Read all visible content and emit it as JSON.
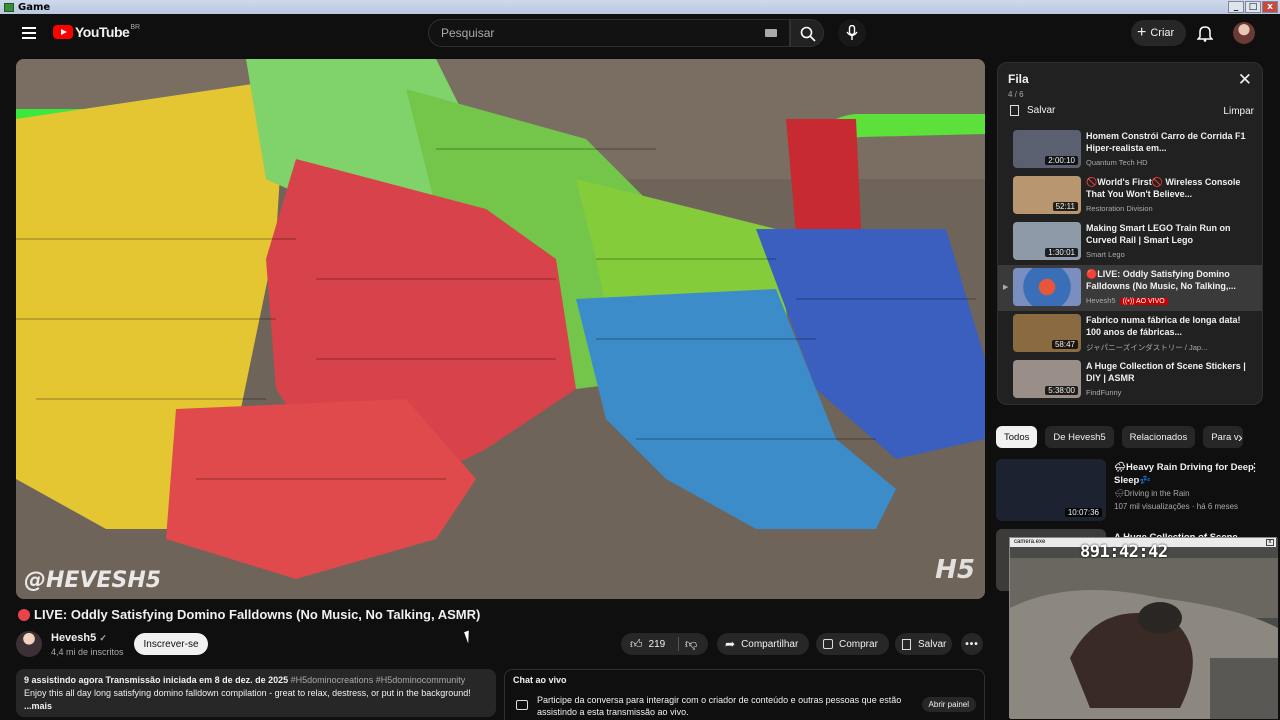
{
  "window": {
    "title": "Game"
  },
  "header": {
    "logo_text": "YouTube",
    "logo_country": "BR",
    "search_placeholder": "Pesquisar",
    "create_label": "Criar"
  },
  "video": {
    "title": "LIVE: Oddly Satisfying Domino Falldowns (No Music, No Talking, ASMR)",
    "watermark_left": "@HEVESH5",
    "watermark_right": "H5",
    "channel_name": "Hevesh5",
    "channel_subs": "4,4 mi de inscritos",
    "subscribe_label": "Inscrever-se",
    "likes": "219",
    "share_label": "Compartilhar",
    "buy_label": "Comprar",
    "save_label": "Salvar",
    "more_label": "•••"
  },
  "description": {
    "stats": "9 assistindo agora  Transmissão iniciada em 8 de dez. de 2025",
    "tags": "#H5dominocreations #H5dominocommunity",
    "text": "Enjoy this all day long satisfying domino falldown compilation - great to relax, destress, or put in the background!",
    "more": "...mais"
  },
  "chat": {
    "title": "Chat ao vivo",
    "message": "Participe da conversa para interagir com o criador de conteúdo e outras pessoas que estão assistindo a esta transmissão ao vivo.",
    "open_label": "Abrir painel"
  },
  "queue": {
    "title": "Fila",
    "count": "4 / 6",
    "save_label": "Salvar",
    "clear_label": "Limpar",
    "items": [
      {
        "title": "Homem Constrói Carro de Corrida F1 Hiper-realista em...",
        "channel": "Quantum Tech HD",
        "duration": "2:00:10",
        "color": "#5a6070"
      },
      {
        "title": "🚫World's First🚫 Wireless Console That You Won't Believe...",
        "channel": "Restoration Division",
        "duration": "52:11",
        "color": "#b89770"
      },
      {
        "title": "Making Smart LEGO Train Run on Curved Rail | Smart Lego",
        "channel": "Smart Lego",
        "duration": "1:30:01",
        "color": "#8e9aa8"
      },
      {
        "title": "🔴LIVE: Oddly Satisfying Domino Falldowns (No Music, No Talking,...",
        "channel": "Hevesh5",
        "live": "((•)) AO VIVO",
        "color": "#4a7ab5"
      },
      {
        "title": "Fabrico numa fábrica de longa data! 100 anos de fábricas...",
        "channel": "ジャパニーズインダストリー / Jap...",
        "duration": "58:47",
        "color": "#8a6a40"
      },
      {
        "title": "A Huge Collection of Scene Stickers | DIY | ASMR",
        "channel": "FindFunny",
        "duration": "5:38:00",
        "color": "#9a8e88"
      }
    ]
  },
  "chips": [
    "Todos",
    "De Hevesh5",
    "Relacionados",
    "Para v"
  ],
  "recommended": [
    {
      "title": "🌧Heavy Rain Driving for Deep Sleep💤",
      "channel": "🌧Driving in the Rain",
      "views": "107 mil visualizações · há 6 meses",
      "duration": "10:07:36"
    },
    {
      "title": "A Huge Collection of Scene",
      "channel": "",
      "views": "",
      "duration": ""
    }
  ],
  "webcam": {
    "filename": "camera.exe",
    "timer": "891:42:42"
  },
  "colors": {
    "accent": "#ff0000",
    "live": "#cc0000",
    "bg": "#0f0f0f"
  }
}
